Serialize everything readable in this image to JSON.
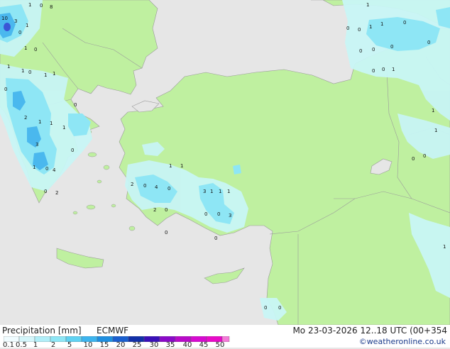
{
  "map": {
    "colors": {
      "sea": "#e6e6e6",
      "land": "#bff0a0",
      "light_precip": "#c8f5f5",
      "medium_precip": "#8ee6f5",
      "heavy_precip": "#4ab8ee",
      "border": "#9a9a9a"
    },
    "point_values": [
      {
        "id": "v1",
        "text": "10"
      },
      {
        "id": "v2",
        "text": "1"
      },
      {
        "id": "v3",
        "text": "0"
      },
      {
        "id": "v4",
        "text": "8"
      },
      {
        "id": "v5",
        "text": "3"
      },
      {
        "id": "v6",
        "text": "1"
      },
      {
        "id": "v7",
        "text": "0"
      },
      {
        "id": "v8",
        "text": "1"
      },
      {
        "id": "v9",
        "text": "0"
      },
      {
        "id": "v10",
        "text": "1"
      },
      {
        "id": "v11",
        "text": "1"
      },
      {
        "id": "v12",
        "text": "0"
      },
      {
        "id": "v13",
        "text": "1"
      },
      {
        "id": "v14",
        "text": "0"
      },
      {
        "id": "v15",
        "text": "1"
      },
      {
        "id": "v16",
        "text": "2"
      },
      {
        "id": "v17",
        "text": "1"
      },
      {
        "id": "v18",
        "text": "1"
      },
      {
        "id": "v19",
        "text": "0"
      },
      {
        "id": "v20",
        "text": "1"
      },
      {
        "id": "v21",
        "text": "3"
      },
      {
        "id": "v22",
        "text": "0"
      },
      {
        "id": "v23",
        "text": "1"
      },
      {
        "id": "v24",
        "text": "0"
      },
      {
        "id": "v25",
        "text": "4"
      },
      {
        "id": "v26",
        "text": "0"
      },
      {
        "id": "v27",
        "text": "2"
      },
      {
        "id": "v28",
        "text": "1"
      },
      {
        "id": "v29",
        "text": "2"
      },
      {
        "id": "v30",
        "text": "0"
      },
      {
        "id": "v31",
        "text": "4"
      },
      {
        "id": "v32",
        "text": "0"
      },
      {
        "id": "v33",
        "text": "2"
      },
      {
        "id": "v34",
        "text": "0"
      },
      {
        "id": "v35",
        "text": "1"
      },
      {
        "id": "v36",
        "text": "1"
      },
      {
        "id": "v37",
        "text": "3"
      },
      {
        "id": "v38",
        "text": "1"
      },
      {
        "id": "v39",
        "text": "1"
      },
      {
        "id": "v40",
        "text": "0"
      },
      {
        "id": "v41",
        "text": "0"
      },
      {
        "id": "v42",
        "text": "3"
      },
      {
        "id": "v43",
        "text": "0"
      },
      {
        "id": "v44",
        "text": "0"
      },
      {
        "id": "v45",
        "text": "1"
      },
      {
        "id": "v46",
        "text": "0"
      },
      {
        "id": "v47",
        "text": "1"
      },
      {
        "id": "v48",
        "text": "0"
      },
      {
        "id": "v49",
        "text": "0"
      },
      {
        "id": "v50",
        "text": "1"
      },
      {
        "id": "v51",
        "text": "0"
      },
      {
        "id": "v52",
        "text": "0"
      },
      {
        "id": "v53",
        "text": "0"
      },
      {
        "id": "v54",
        "text": "0"
      },
      {
        "id": "v55",
        "text": "0"
      },
      {
        "id": "v56",
        "text": "0"
      },
      {
        "id": "v57",
        "text": "1"
      },
      {
        "id": "v58",
        "text": "1"
      },
      {
        "id": "v59",
        "text": "1"
      },
      {
        "id": "v60",
        "text": "0"
      },
      {
        "id": "v61",
        "text": "0"
      },
      {
        "id": "v62",
        "text": "1"
      },
      {
        "id": "v63",
        "text": "0"
      },
      {
        "id": "v64",
        "text": "0"
      }
    ]
  },
  "footer": {
    "title": "Precipitation [mm]",
    "model": "ECMWF",
    "run_info": "Mo 23-03-2026 12..18 UTC (00+354",
    "credit": "©weatheronline.co.uk",
    "scale_labels": [
      "0.1",
      "0.5",
      "1",
      "2",
      "5",
      "10",
      "15",
      "20",
      "25",
      "30",
      "35",
      "40",
      "45",
      "50"
    ],
    "scale_colors": [
      "#f0fcff",
      "#d4f6fb",
      "#b0eef8",
      "#8ee6f5",
      "#60d2f2",
      "#3cb4ee",
      "#1f8fe0",
      "#1a5fcf",
      "#1230a8",
      "#3a10b8",
      "#8a0ac8",
      "#b80ac8",
      "#d60ad0",
      "#e80ac8",
      "#f47ad8"
    ]
  }
}
